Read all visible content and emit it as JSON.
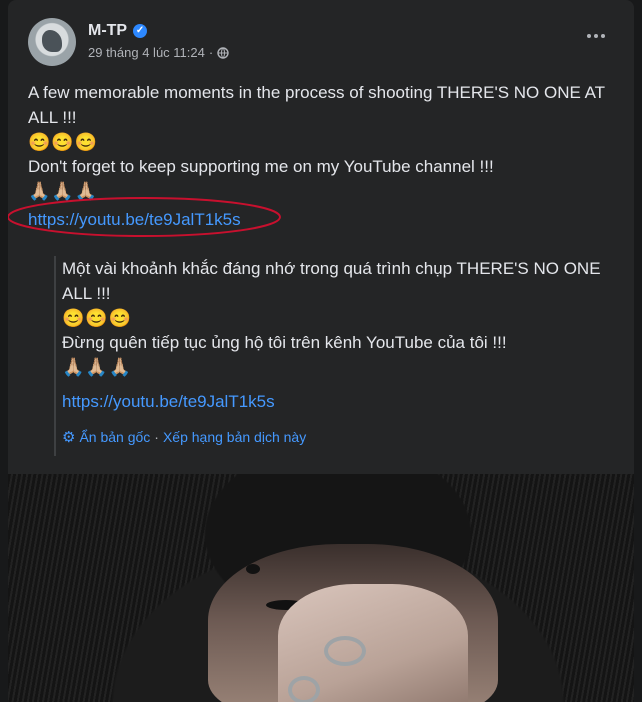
{
  "post": {
    "author": "M-TP",
    "timestamp": "29 tháng 4 lúc 11:24",
    "dot_separator": "·",
    "text_line1": "A few memorable moments in the process of shooting THERE'S NO ONE AT ALL !!!",
    "emoji1": "😊😊😊",
    "text_line2": "Don't forget to keep supporting me on my YouTube channel !!!",
    "emoji2": "🙏🏼🙏🏼🙏🏼",
    "link": "https://youtu.be/te9JalT1k5s"
  },
  "translation": {
    "text_line1": "Một vài khoảnh khắc đáng nhớ trong quá trình chụp THERE'S NO ONE ALL !!!",
    "emoji1": "😊😊😊",
    "text_line2": "Đừng quên tiếp tục ủng hộ tôi trên kênh YouTube của tôi !!!",
    "emoji2": "🙏🏼🙏🏼🙏🏼",
    "link": "https://youtu.be/te9JalT1k5s",
    "hide_original": "Ẩn bản gốc",
    "sep": "·",
    "rate_translation": "Xếp hạng bản dịch này"
  },
  "colors": {
    "background": "#18191a",
    "card": "#242526",
    "link": "#4599ff",
    "verified": "#2d88ff",
    "annotation_circle": "#c8102e"
  },
  "icons": [
    "verified-badge-icon",
    "globe-icon",
    "more-options-icon",
    "gear-icon"
  ]
}
